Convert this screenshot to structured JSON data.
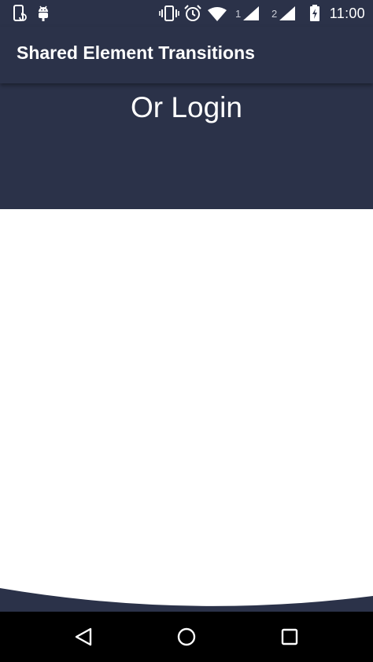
{
  "status_bar": {
    "time": "11:00",
    "sim1_label": "1",
    "sim2_label": "2",
    "icons": [
      "phone-update-icon",
      "android-debug-icon",
      "vibrate-icon",
      "alarm-icon",
      "wifi-icon",
      "signal-sim1-icon",
      "signal-sim2-icon",
      "battery-charging-icon"
    ]
  },
  "app_bar": {
    "title": "Shared Element Transitions"
  },
  "header_panel": {
    "heading": "Or Login"
  },
  "nav_bar": {
    "icons": [
      "back-icon",
      "home-icon",
      "recents-icon"
    ]
  },
  "colors": {
    "primary": "#2b3249",
    "content_background": "#ffffff",
    "nav_background": "#000000",
    "text_on_primary": "#ffffff"
  }
}
